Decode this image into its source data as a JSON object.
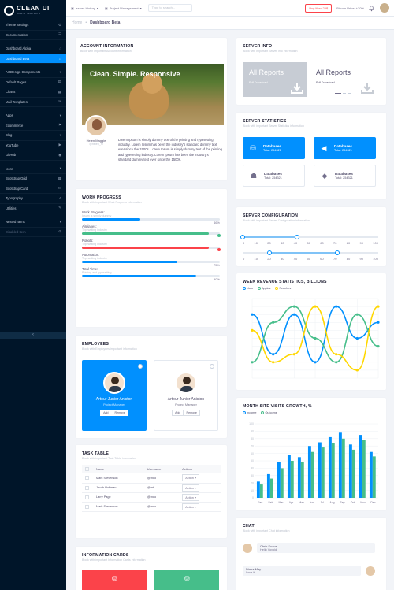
{
  "brand": {
    "title": "CLEAN UI",
    "subtitle": "ADMIN TEMPLATE"
  },
  "sidebar": {
    "items": [
      {
        "label": "Theme Settings",
        "icon": "gear-icon"
      },
      {
        "label": "Documentation",
        "icon": "book-icon"
      },
      {
        "label": "Dashboard Alpha",
        "icon": "home-icon"
      },
      {
        "label": "Dashboard Beta",
        "icon": "home-icon",
        "active": true
      },
      {
        "label": "AntDesign Components",
        "icon": "chevron-down-icon"
      },
      {
        "label": "Default Pages",
        "icon": "pages-icon"
      },
      {
        "label": "Charts",
        "icon": "chart-icon"
      },
      {
        "label": "Mail Templates",
        "icon": "mail-icon"
      },
      {
        "label": "Apps",
        "icon": "apps-icon"
      },
      {
        "label": "Ecommerce",
        "icon": "cart-icon"
      },
      {
        "label": "Blog",
        "icon": "pencil-icon"
      },
      {
        "label": "YouTube",
        "icon": "youtube-icon"
      },
      {
        "label": "GitHub",
        "icon": "github-icon"
      },
      {
        "label": "Icons",
        "icon": "star-icon"
      },
      {
        "label": "Bootstrap Grid",
        "icon": "grid-icon"
      },
      {
        "label": "Bootstrap Card",
        "icon": "card-icon"
      },
      {
        "label": "Typography",
        "icon": "text-icon"
      },
      {
        "label": "Utilities",
        "icon": "tool-icon"
      },
      {
        "label": "Nested Items",
        "icon": "list-icon"
      },
      {
        "label": "Disabled Item",
        "icon": "block-icon",
        "disabled": true
      }
    ]
  },
  "topbar": {
    "issues": "Issues History",
    "projects": "Project Management",
    "search_placeholder": "Type to search...",
    "buy": "Buy Now 25$",
    "btc_label": "Bitcoin Price:",
    "btc_change": "+20%"
  },
  "breadcrumb": {
    "home": "Home",
    "current": "Dashboard Beta"
  },
  "account": {
    "title": "ACCOUNT INFORMATION",
    "subtitle": "Block with important Account information",
    "image_caption": "Clean. Simple. Responsive",
    "author_name": "Helen Maggie",
    "author_handle": "@helen_m",
    "text": "Lorem Ipsum is simply dummy text of the printing and typesetting industry. Lorem Ipsum has been the industry's standard dummy text ever since the 1500s. Lorem Ipsum is simply dummy text of the printing and typesetting industry. Lorem Ipsum has been the industry's standard dummy text ever since the 1500s."
  },
  "work": {
    "title": "WORK PROGRESS",
    "subtitle": "Block with important Work Progress information",
    "items": [
      {
        "label": "Work Progress:",
        "sub": "Ipsum is simply dummy",
        "value": "46%",
        "percent": 46,
        "color": "#0190fe"
      },
      {
        "label": "Airplanes:",
        "sub": "Typewriting industry",
        "percent": 100,
        "color": "#46be8a",
        "status": "done"
      },
      {
        "label": "Robots:",
        "sub": "Typewriting industry",
        "percent": 100,
        "color": "#fb434a",
        "status": "error"
      },
      {
        "label": "Automation:",
        "sub": "Typewriting industry",
        "value": "75%",
        "percent": 75,
        "color": "#0190fe"
      },
      {
        "label": "Total Time:",
        "sub": "Printing and typesetting",
        "value": "90%",
        "percent": 90,
        "color": "#0190fe"
      }
    ]
  },
  "employees": {
    "title": "EMPLOYEES",
    "subtitle": "Block with Employees important information",
    "cards": [
      {
        "name": "Artour Junior Aniston",
        "role": "Project Manager",
        "add": "Add",
        "remove": "Remove"
      },
      {
        "name": "Artour Junior Aniston",
        "role": "Project Manager",
        "add": "Add",
        "remove": "Remove"
      }
    ]
  },
  "tasks": {
    "title": "TASK TABLE",
    "subtitle": "Block with important Task Table information",
    "columns": [
      "Name",
      "Username",
      "Actions"
    ],
    "rows": [
      {
        "name": "Mark Stevenson",
        "user": "@mdo",
        "action": "Action"
      },
      {
        "name": "Jacob Hoffman",
        "user": "@fat",
        "action": "Action"
      },
      {
        "name": "Larry Page",
        "user": "@mdo",
        "action": "Action"
      },
      {
        "name": "Mark Stevenson",
        "user": "@mdo",
        "action": "Action"
      }
    ]
  },
  "info_cards": {
    "title": "INFORMATION CARDS",
    "subtitle": "Block with important Information Cards information"
  },
  "server_info": {
    "title": "SERVER INFO",
    "subtitle": "Block with important Server Info information",
    "report1": "All Reports",
    "report1_sub": "Pdf Download",
    "report2": "All Reports",
    "report2_sub": "Pdf Download"
  },
  "server_stats": {
    "title": "SERVER STATISTICS",
    "subtitle": "Block with important Server Statistics information",
    "items": [
      {
        "title": "Databases",
        "total": "Total: 254321",
        "style": "blue",
        "icon": "database-icon"
      },
      {
        "title": "Databases",
        "total": "Total: 254321",
        "style": "blue",
        "icon": "megaphone-icon"
      },
      {
        "title": "Databases",
        "total": "Total: 254321",
        "style": "white",
        "icon": "users-icon"
      },
      {
        "title": "Databases",
        "total": "Total: 254321",
        "style": "white",
        "icon": "tag-icon"
      }
    ]
  },
  "server_config": {
    "title": "SERVER CONFIGURATION",
    "subtitle": "Block with important Server Configuration information",
    "ticks1": [
      "0",
      "10",
      "20",
      "30",
      "40",
      "50",
      "60",
      "70",
      "80",
      "90",
      "100"
    ],
    "ticks2": [
      "0",
      "10",
      "20",
      "30",
      "40",
      "50",
      "60",
      "70",
      "80",
      "90",
      "100"
    ],
    "range1": [
      0,
      40
    ],
    "range2": [
      20,
      70
    ]
  },
  "week_revenue": {
    "title": "WEEK REVENUE STATISTICS, BILLIONS",
    "legend": [
      "Nuts",
      "Apples",
      "Peaches"
    ]
  },
  "visits": {
    "title": "MONTH SITE VISITS GROWTH, %",
    "legend": [
      "Income",
      "Outcome"
    ]
  },
  "chat": {
    "title": "CHAT",
    "subtitle": "Block with important Chat information",
    "messages": [
      {
        "name": "Chris Evans",
        "text": "Hello Vovoid!"
      },
      {
        "name": "Diana May",
        "text": "Love it!"
      }
    ]
  },
  "chart_data": [
    {
      "type": "line",
      "title": "WEEK REVENUE STATISTICS, BILLIONS",
      "ylim": [
        0,
        10
      ],
      "x": [
        "1",
        "2",
        "3",
        "4",
        "5",
        "6",
        "7"
      ],
      "series": [
        {
          "name": "Nuts",
          "values": [
            8,
            3,
            8,
            2,
            9,
            5,
            7
          ],
          "color": "#0190fe"
        },
        {
          "name": "Apples",
          "values": [
            2,
            7,
            9,
            5,
            2,
            8,
            4
          ],
          "color": "#46be8a"
        },
        {
          "name": "Peaches",
          "values": [
            6,
            2,
            3,
            9,
            3,
            1,
            9
          ],
          "color": "#ffd700"
        }
      ]
    },
    {
      "type": "bar",
      "title": "MONTH SITE VISITS GROWTH, %",
      "ylim": [
        0,
        100
      ],
      "categories": [
        "Jan",
        "Feb",
        "Mar",
        "Apr",
        "May",
        "Jun",
        "Jul",
        "Aug",
        "Sep",
        "Oct",
        "Nov",
        "Dec"
      ],
      "series": [
        {
          "name": "Income",
          "values": [
            22,
            32,
            48,
            58,
            55,
            70,
            75,
            82,
            88,
            72,
            85,
            62
          ],
          "color": "#0190fe"
        },
        {
          "name": "Outcome",
          "values": [
            18,
            26,
            40,
            50,
            48,
            62,
            68,
            74,
            80,
            65,
            78,
            56
          ],
          "color": "#46be8a"
        }
      ]
    }
  ]
}
